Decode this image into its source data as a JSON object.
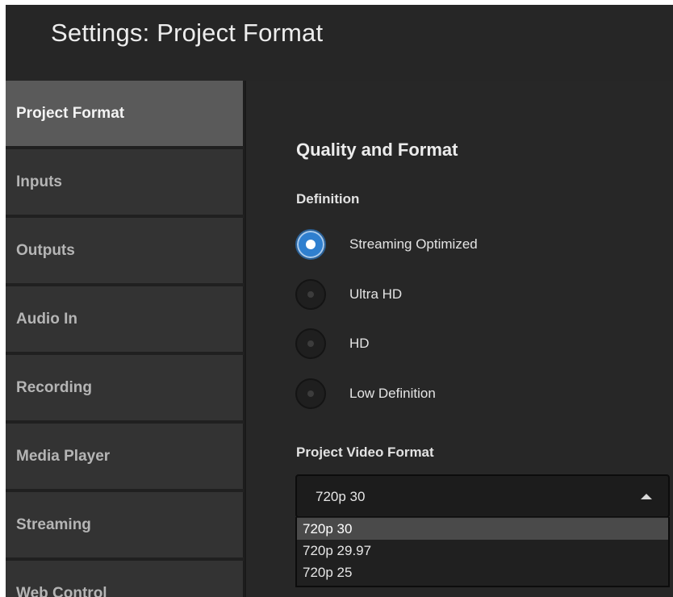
{
  "window": {
    "title": "Settings: Project Format"
  },
  "sidebar": {
    "items": [
      {
        "label": "Project Format",
        "active": true
      },
      {
        "label": "Inputs"
      },
      {
        "label": "Outputs"
      },
      {
        "label": "Audio In"
      },
      {
        "label": "Recording"
      },
      {
        "label": "Media Player"
      },
      {
        "label": "Streaming"
      },
      {
        "label": "Web Control"
      }
    ]
  },
  "main": {
    "section_title": "Quality and Format",
    "definition": {
      "label": "Definition",
      "options": [
        {
          "label": "Streaming Optimized",
          "selected": true
        },
        {
          "label": "Ultra HD",
          "selected": false
        },
        {
          "label": "HD",
          "selected": false
        },
        {
          "label": "Low Definition",
          "selected": false
        }
      ]
    },
    "video_format": {
      "label": "Project Video Format",
      "value": "720p 30",
      "options": [
        "720p 30",
        "720p 29.97",
        "720p 25"
      ]
    }
  },
  "colors": {
    "accent": "#2f7fcf",
    "active_nav": "#5a5a5a",
    "background": "#272727"
  }
}
